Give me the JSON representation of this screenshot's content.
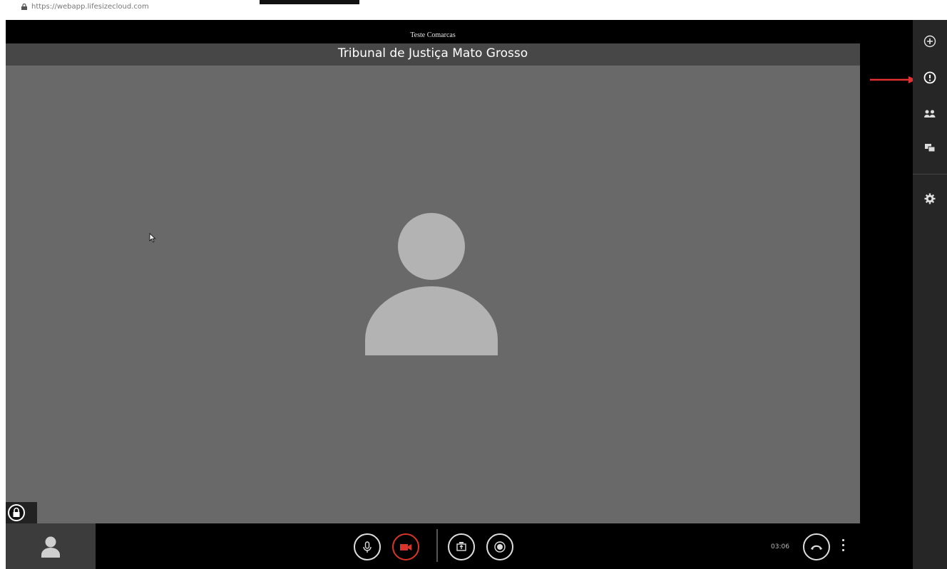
{
  "browser": {
    "url": "https://webapp.lifesizecloud.com"
  },
  "meeting": {
    "conference_name": "Teste Comarcas",
    "title": "Tribunal de Justiça Mato Grosso",
    "timer": "03:06"
  },
  "icons": {
    "lock_secure": "lock-icon",
    "mic": "microphone-icon",
    "camera": "camera-off-icon",
    "share": "share-screen-icon",
    "record": "record-icon",
    "hangup": "hang-up-icon",
    "add": "add-icon",
    "info": "info-icon",
    "participants": "participants-icon",
    "chat": "chat-icon",
    "settings": "gear-icon"
  },
  "colors": {
    "video_bg": "#696969",
    "title_strip": "#474747",
    "sidebar_bg": "#262626",
    "camera_off_red": "#d9342b",
    "annotation_arrow": "#e03030"
  }
}
